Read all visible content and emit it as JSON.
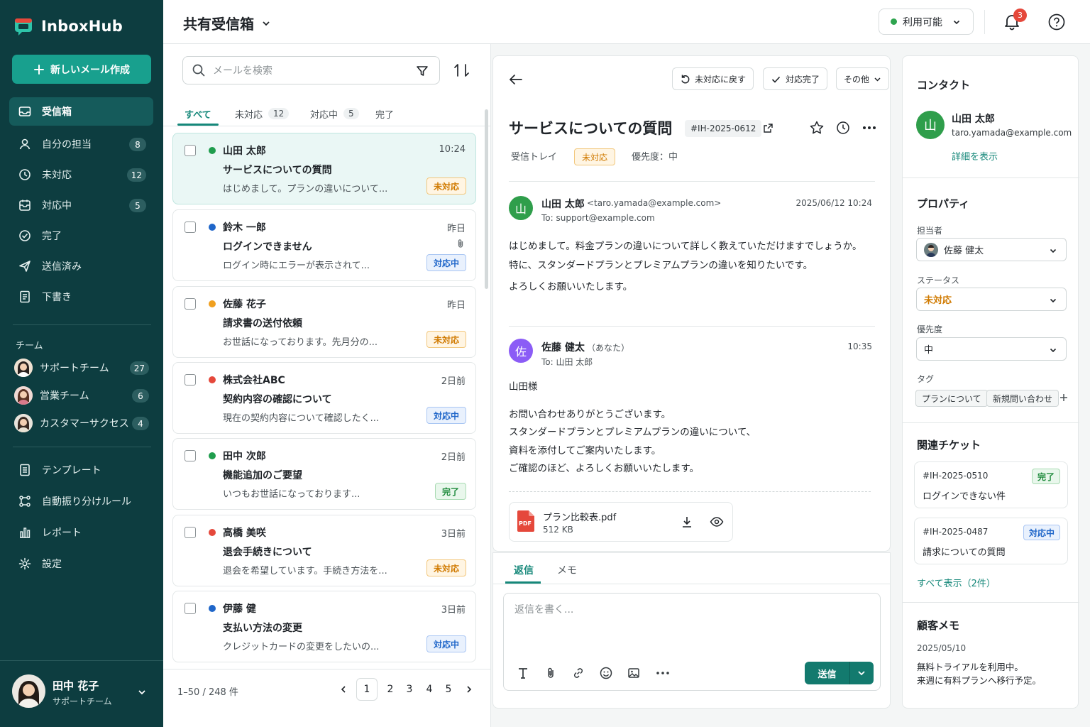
{
  "app": {
    "name": "InboxHub"
  },
  "sidebar": {
    "compose_label": "新しいメール作成",
    "nav": [
      {
        "label": "受信箱",
        "icon": "inbox-icon",
        "count": ""
      },
      {
        "label": "自分の担当",
        "icon": "user-icon",
        "count": "8"
      },
      {
        "label": "未対応",
        "icon": "clock-icon",
        "count": "12"
      },
      {
        "label": "対応中",
        "icon": "inbox-tray-icon",
        "count": "5"
      },
      {
        "label": "完了",
        "icon": "check-circle-icon",
        "count": ""
      },
      {
        "label": "送信済み",
        "icon": "send-icon",
        "count": ""
      },
      {
        "label": "下書き",
        "icon": "draft-icon",
        "count": ""
      }
    ],
    "team_heading": "チーム",
    "teams": [
      {
        "label": "サポートチーム",
        "count": "27"
      },
      {
        "label": "営業チーム",
        "count": "6"
      },
      {
        "label": "カスタマーサクセス",
        "count": "4"
      }
    ],
    "tools": [
      {
        "label": "テンプレート",
        "icon": "template-icon"
      },
      {
        "label": "自動振り分けルール",
        "icon": "rules-icon"
      },
      {
        "label": "レポート",
        "icon": "chart-icon"
      },
      {
        "label": "設定",
        "icon": "gear-icon"
      }
    ],
    "user": {
      "name": "田中 花子",
      "team": "サポートチーム"
    }
  },
  "header": {
    "title": "共有受信箱",
    "status": "利用可能",
    "notification_count": "3",
    "colors": {
      "accent": "#16887a",
      "sidebar": "#0d3d40",
      "available": "#2ea44f",
      "badge": "#e5483b"
    }
  },
  "list": {
    "search_placeholder": "メールを検索",
    "tabs": [
      {
        "label": "すべて",
        "count": ""
      },
      {
        "label": "未対応",
        "count": "12"
      },
      {
        "label": "対応中",
        "count": "5"
      },
      {
        "label": "完了",
        "count": ""
      }
    ],
    "mails": [
      {
        "sender": "山田 太郎",
        "time": "10:24",
        "subject": "サービスについての質問",
        "preview": "はじめまして。プランの違いについて...",
        "status": "未対応",
        "status_type": "pending",
        "dot": "#1f9d4d",
        "attachment": false
      },
      {
        "sender": "鈴木 一郎",
        "time": "昨日",
        "subject": "ログインできません",
        "preview": "ログイン時にエラーが表示されて...",
        "status": "対応中",
        "status_type": "progress",
        "dot": "#1f66c9",
        "attachment": true
      },
      {
        "sender": "佐藤 花子",
        "time": "昨日",
        "subject": "請求書の送付依頼",
        "preview": "お世話になっております。先月分の...",
        "status": "未対応",
        "status_type": "pending",
        "dot": "#f0a020",
        "attachment": false
      },
      {
        "sender": "株式会社ABC",
        "time": "2日前",
        "subject": "契約内容の確認について",
        "preview": "現在の契約内容について確認したく...",
        "status": "対応中",
        "status_type": "progress",
        "dot": "#e5483b",
        "attachment": false
      },
      {
        "sender": "田中 次郎",
        "time": "2日前",
        "subject": "機能追加のご要望",
        "preview": "いつもお世話になっております...",
        "status": "完了",
        "status_type": "done",
        "dot": "#1f9d4d",
        "attachment": false
      },
      {
        "sender": "高橋 美咲",
        "time": "3日前",
        "subject": "退会手続きについて",
        "preview": "退会を希望しています。手続き方法を...",
        "status": "未対応",
        "status_type": "pending",
        "dot": "#e5483b",
        "attachment": false
      },
      {
        "sender": "伊藤 健",
        "time": "3日前",
        "subject": "支払い方法の変更",
        "preview": "クレジットカードの変更をしたいの...",
        "status": "対応中",
        "status_type": "progress",
        "dot": "#1f66c9",
        "attachment": false
      }
    ],
    "range": "1–50 / 248 件",
    "pages": [
      "1",
      "2",
      "3",
      "4",
      "5"
    ]
  },
  "detail": {
    "toolbar": {
      "reopen": "未対応に戻す",
      "done": "対応完了",
      "more": "その他"
    },
    "title": "サービスについての質問",
    "ticket_id": "#IH-2025-0612",
    "folder": "受信トレイ",
    "status": "未対応",
    "priority": "優先度：中",
    "message1": {
      "initial": "山",
      "sender": "山田 太郎",
      "email": "<taro.yamada@example.com>",
      "to": "To: support@example.com",
      "date": "2025/06/12 10:24",
      "lines": [
        "はじめまして。料金プランの違いについて詳しく教えていただけますでしょうか。",
        "特に、スタンダードプランとプレミアムプランの違いを知りたいです。",
        "よろしくお願いいたします。"
      ]
    },
    "message2": {
      "initial": "佐",
      "sender": "佐藤 健太",
      "you": "（あなた）",
      "to": "To: 山田 太郎",
      "time": "10:35",
      "greeting": "山田様",
      "lines": [
        "お問い合わせありがとうございます。",
        "スタンダードプランとプレミアムプランの違いについて、",
        "資料を添付してご案内いたします。",
        "ご確認のほど、よろしくお願いいたします。"
      ]
    },
    "attachment": {
      "icon_text": "PDF",
      "name": "プラン比較表.pdf",
      "size": "512 KB"
    }
  },
  "reply": {
    "tabs": [
      "返信",
      "メモ"
    ],
    "placeholder": "返信を書く...",
    "send": "送信"
  },
  "contact": {
    "heading": "コンタクト",
    "initial": "山",
    "name": "山田 太郎",
    "email": "taro.yamada@example.com",
    "details_link": "詳細を表示"
  },
  "properties": {
    "heading": "プロパティ",
    "assignee_label": "担当者",
    "assignee": "佐藤 健太",
    "status_label": "ステータス",
    "status": "未対応",
    "priority_label": "優先度",
    "priority": "中",
    "tags_label": "タグ",
    "tags": [
      "プランについて",
      "新規問い合わせ"
    ]
  },
  "related": {
    "heading": "関連チケット",
    "tickets": [
      {
        "id": "#IH-2025-0510",
        "title": "ログインできない件",
        "status": "完了",
        "status_type": "done"
      },
      {
        "id": "#IH-2025-0487",
        "title": "請求についての質問",
        "status": "対応中",
        "status_type": "progress"
      }
    ],
    "show_all": "すべて表示（2件）"
  },
  "notes": {
    "heading": "顧客メモ",
    "date": "2025/05/10",
    "lines": [
      "無料トライアルを利用中。",
      "来週に有料プランへ移行予定。"
    ]
  }
}
